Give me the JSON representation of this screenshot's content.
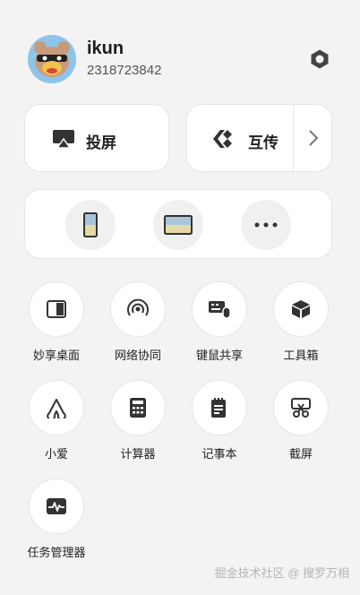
{
  "user": {
    "name": "ikun",
    "id": "2318723842"
  },
  "cast": {
    "label": "投屏",
    "icon": "screen-cast-icon"
  },
  "transfer": {
    "label": "互传",
    "icon": "transfer-icon",
    "more_icon": "chevron-right-icon"
  },
  "devices": [
    {
      "name": "phone-device",
      "icon": "phone-icon"
    },
    {
      "name": "tablet-device",
      "icon": "tablet-icon"
    },
    {
      "name": "more-devices",
      "icon": "more-dots-icon"
    }
  ],
  "tools": [
    {
      "label": "妙享桌面",
      "icon": "desktop-share-icon"
    },
    {
      "label": "网络协同",
      "icon": "network-collab-icon"
    },
    {
      "label": "键鼠共享",
      "icon": "keyboard-mouse-icon"
    },
    {
      "label": "工具箱",
      "icon": "toolbox-icon"
    },
    {
      "label": "小爱",
      "icon": "xiaoai-icon"
    },
    {
      "label": "计算器",
      "icon": "calculator-icon"
    },
    {
      "label": "记事本",
      "icon": "notepad-icon"
    },
    {
      "label": "截屏",
      "icon": "screenshot-icon"
    },
    {
      "label": "任务管理器",
      "icon": "task-manager-icon"
    }
  ],
  "watermark": "掘金技术社区 @ 搜罗万相",
  "colors": {
    "background": "#f3f3f3",
    "card": "#ffffff",
    "icon": "#333333"
  }
}
